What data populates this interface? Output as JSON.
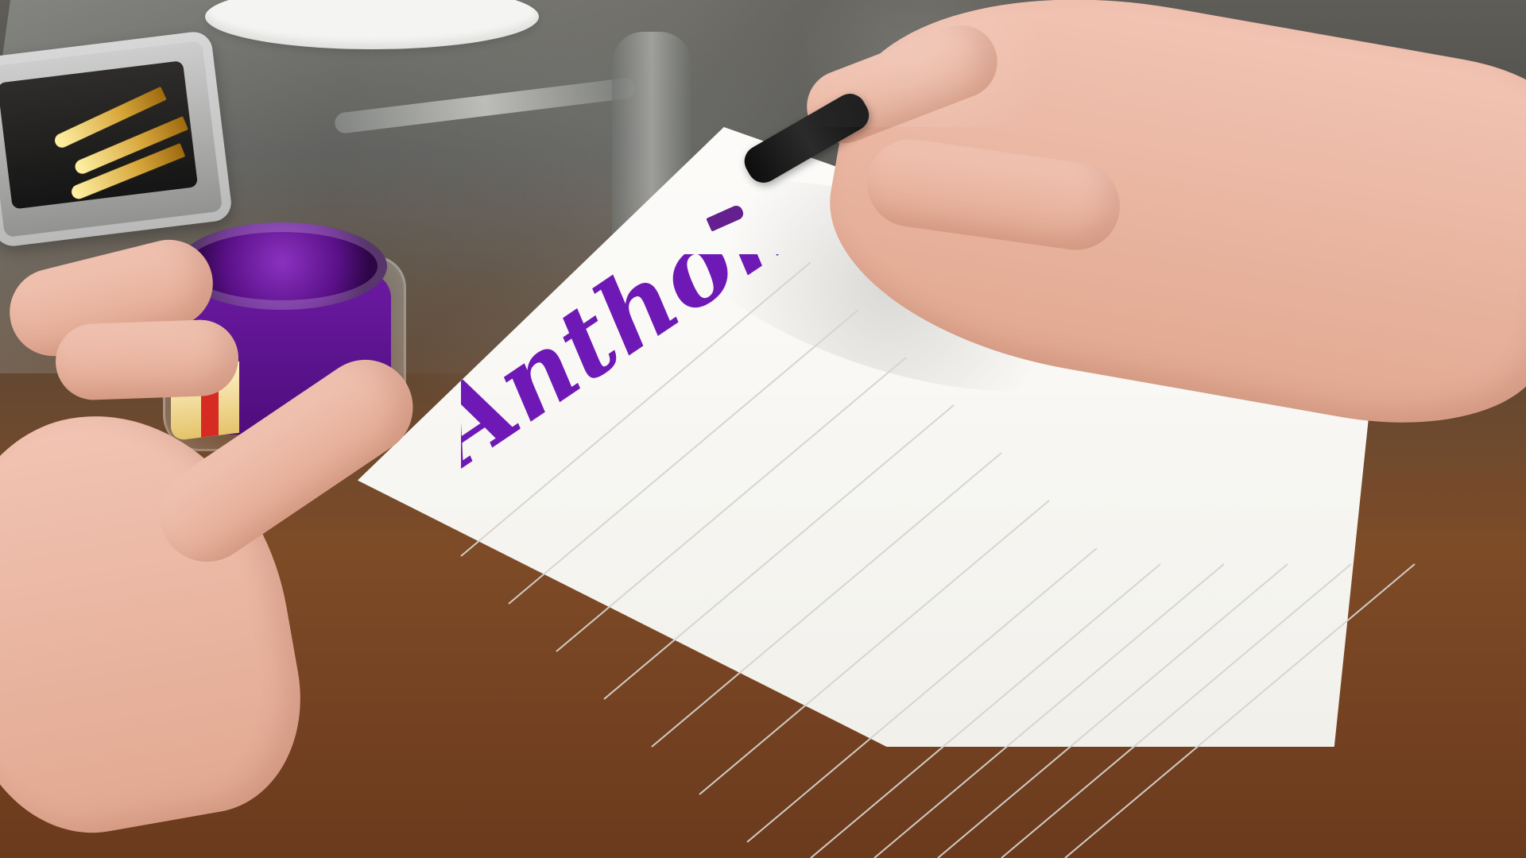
{
  "scene": {
    "writing_text": "Anthony",
    "colors": {
      "ink": "#6e19b5",
      "paper": "#f7f5ef",
      "skin": "#e9b59f",
      "table": "#7e4b27",
      "pen": "#101010"
    }
  }
}
